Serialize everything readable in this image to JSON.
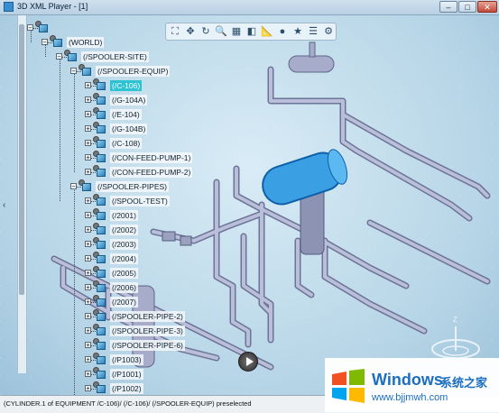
{
  "window": {
    "title": "3D XML Player - [1]",
    "minimize_glyph": "–",
    "maximize_glyph": "□",
    "close_glyph": "✕"
  },
  "toolbar": {
    "buttons": [
      {
        "name": "fit-all-icon",
        "glyph": "⛶"
      },
      {
        "name": "pan-icon",
        "glyph": "✥"
      },
      {
        "name": "rotate-icon",
        "glyph": "↻"
      },
      {
        "name": "zoom-icon",
        "glyph": "🔍"
      },
      {
        "name": "normal-view-icon",
        "glyph": "▦"
      },
      {
        "name": "section-icon",
        "glyph": "◧"
      },
      {
        "name": "measure-icon",
        "glyph": "📐"
      },
      {
        "name": "render-icon",
        "glyph": "●"
      },
      {
        "name": "favorite-icon",
        "glyph": "★"
      },
      {
        "name": "properties-icon",
        "glyph": "☰"
      },
      {
        "name": "settings-icon",
        "glyph": "⚙"
      }
    ]
  },
  "tree": {
    "nodes": [
      {
        "label": "",
        "depth": 0,
        "expander": "−",
        "icon": true
      },
      {
        "label": "(WORLD)",
        "depth": 1,
        "expander": "−"
      },
      {
        "label": "(/SPOOLER-SITE)",
        "depth": 2,
        "expander": "−"
      },
      {
        "label": "(/SPOOLER-EQUIP)",
        "depth": 3,
        "expander": "−"
      },
      {
        "label": "(/C-106)",
        "depth": 4,
        "expander": "+",
        "selected": true
      },
      {
        "label": "(/G-104A)",
        "depth": 4,
        "expander": "+"
      },
      {
        "label": "(/E-104)",
        "depth": 4,
        "expander": "+"
      },
      {
        "label": "(/G-104B)",
        "depth": 4,
        "expander": "+"
      },
      {
        "label": "(/C-108)",
        "depth": 4,
        "expander": "+"
      },
      {
        "label": "(/CON-FEED-PUMP-1)",
        "depth": 4,
        "expander": "+"
      },
      {
        "label": "(/CON-FEED-PUMP-2)",
        "depth": 4,
        "expander": "+"
      },
      {
        "label": "(/SPOOLER-PIPES)",
        "depth": 3,
        "expander": "−"
      },
      {
        "label": "(/SPOOL-TEST)",
        "depth": 4,
        "expander": "+"
      },
      {
        "label": "(/2001)",
        "depth": 4,
        "expander": "+"
      },
      {
        "label": "(/2002)",
        "depth": 4,
        "expander": "+"
      },
      {
        "label": "(/2003)",
        "depth": 4,
        "expander": "+"
      },
      {
        "label": "(/2004)",
        "depth": 4,
        "expander": "+"
      },
      {
        "label": "(/2005)",
        "depth": 4,
        "expander": "+"
      },
      {
        "label": "(/2006)",
        "depth": 4,
        "expander": "+"
      },
      {
        "label": "(/2007)",
        "depth": 4,
        "expander": "+"
      },
      {
        "label": "(/SPOOLER-PIPE-2)",
        "depth": 4,
        "expander": "+"
      },
      {
        "label": "(/SPOOLER-PIPE-3)",
        "depth": 4,
        "expander": "+"
      },
      {
        "label": "(/SPOOLER-PIPE-6)",
        "depth": 4,
        "expander": "+"
      },
      {
        "label": "(/P1003)",
        "depth": 4,
        "expander": "+"
      },
      {
        "label": "(/P1001)",
        "depth": 4,
        "expander": "+"
      },
      {
        "label": "(/P1002)",
        "depth": 4,
        "expander": "+"
      }
    ]
  },
  "viewer": {
    "left_arrow": "‹",
    "compass_letter": "Z"
  },
  "status": {
    "text": "(CYLINDER.1 of EQUIPMENT /C-106)/ (/C-106)/ (/SPOOLER-EQUIP) preselected"
  },
  "watermark": {
    "title": "Windows",
    "chinese": "系统之家",
    "url": "www.bjjmwh.com"
  },
  "colors": {
    "selection": "#2ec3d3",
    "highlight_vessel": "#3a9fe3",
    "pipe": "#9aa2bf",
    "background": "#b5d4e6"
  }
}
